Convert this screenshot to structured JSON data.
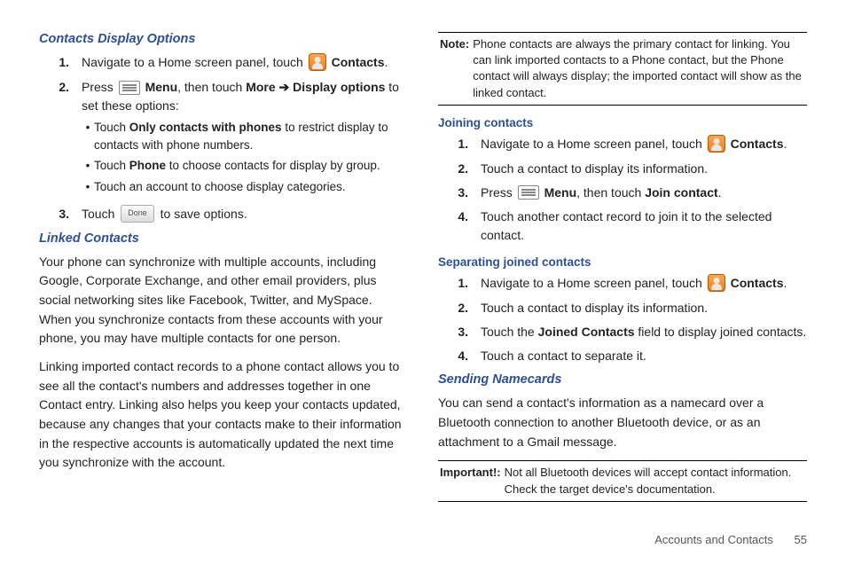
{
  "left": {
    "h1": "Contacts Display Options",
    "step1": {
      "num": "1.",
      "t1": "Navigate to a Home screen panel, touch ",
      "t2": "Contacts",
      "t3": "."
    },
    "step2": {
      "num": "2.",
      "t1": "Press ",
      "t2": "Menu",
      "t3": ", then touch ",
      "t4": "More",
      "arrow": " ➔ ",
      "t5": "Display options",
      "t6": " to set these options:"
    },
    "b1": {
      "t1": "Touch ",
      "t2": "Only contacts with phones",
      "t3": " to restrict display to contacts with phone numbers."
    },
    "b2": {
      "t1": "Touch ",
      "t2": "Phone",
      "t3": " to choose contacts for display by group."
    },
    "b3": {
      "t1": "Touch an account to choose display categories."
    },
    "step3": {
      "num": "3.",
      "t1": "Touch ",
      "done": "Done",
      "t2": " to save options."
    },
    "h2": "Linked Contacts",
    "p1": "Your phone can synchronize with multiple accounts, including Google, Corporate Exchange, and other email providers, plus social networking sites like Facebook, Twitter, and MySpace. When you synchronize contacts from these accounts with your phone, you may have multiple contacts for one person.",
    "p2": "Linking imported contact records to a phone contact allows you to see all the contact's numbers and addresses together in one Contact entry. Linking also helps you keep your contacts updated, because any changes that your contacts make to their information in the respective accounts is automatically updated the next time you synchronize with the account."
  },
  "right": {
    "note1": {
      "label": "Note:",
      "body": "Phone contacts are always the primary contact for linking. You can link imported contacts to a Phone contact, but the Phone contact will always display; the imported contact will show as the linked contact."
    },
    "h3": "Joining contacts",
    "j1": {
      "num": "1.",
      "t1": "Navigate to a Home screen panel, touch ",
      "t2": "Contacts",
      "t3": "."
    },
    "j2": {
      "num": "2.",
      "t1": "Touch a contact to display its information."
    },
    "j3": {
      "num": "3.",
      "t1": "Press ",
      "t2": "Menu",
      "t3": ", then touch ",
      "t4": "Join contact",
      "t5": "."
    },
    "j4": {
      "num": "4.",
      "t1": "Touch another contact record to join it to the selected contact."
    },
    "h4": "Separating joined contacts",
    "s1": {
      "num": "1.",
      "t1": "Navigate to a Home screen panel, touch ",
      "t2": "Contacts",
      "t3": "."
    },
    "s2": {
      "num": "2.",
      "t1": "Touch a contact to display its information."
    },
    "s3": {
      "num": "3.",
      "t1": "Touch the ",
      "t2": "Joined Contacts",
      "t3": " field to display joined contacts."
    },
    "s4": {
      "num": "4.",
      "t1": "Touch a contact to separate it."
    },
    "h5": "Sending Namecards",
    "p3": "You can send a contact's information as a namecard over a Bluetooth connection to another Bluetooth device, or as an attachment to a Gmail message.",
    "note2": {
      "label": "Important!:",
      "body": "Not all Bluetooth devices will accept contact information. Check the target device's documentation."
    }
  },
  "footer": {
    "section": "Accounts and Contacts",
    "page": "55"
  }
}
